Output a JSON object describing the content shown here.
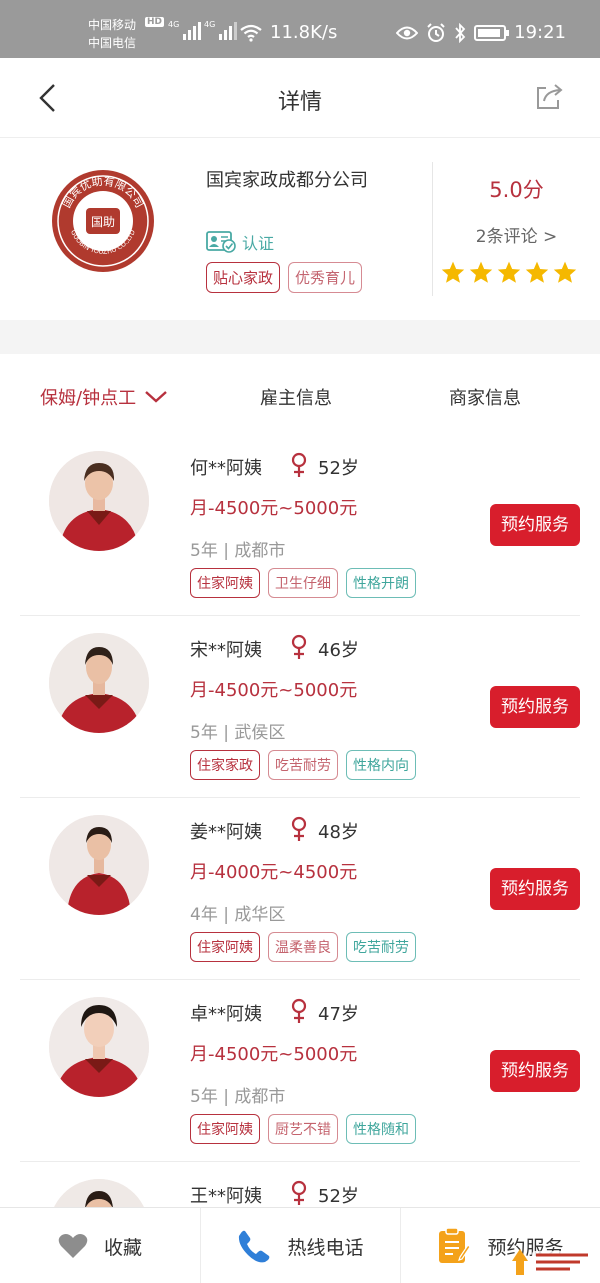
{
  "status_bar": {
    "carrier1": "中国移动",
    "carrier2": "中国电信",
    "hd": "HD",
    "net1": "4G",
    "net2": "4G",
    "speed": "11.8K/s",
    "time": "19:21"
  },
  "nav": {
    "title": "详情"
  },
  "company": {
    "name": "国宾家政成都分公司",
    "logo_text": "国宾优助有限公司",
    "logo_en": "GUOBIN YOUZHU CO.,LTD",
    "logo_mark": "国助",
    "cert_label": "认证",
    "tags": [
      "贴心家政",
      "优秀育儿"
    ],
    "score": "5.0分",
    "reviews": "2条评论 >",
    "stars": 5
  },
  "tabs": [
    "保姆/钟点工",
    "雇主信息",
    "商家信息"
  ],
  "workers": [
    {
      "name": "何**阿姨",
      "age": "52岁",
      "salary": "月-4500元~5000元",
      "meta": "5年 | 成都市",
      "tags": [
        "住家阿姨",
        "卫生仔细",
        "性格开朗"
      ],
      "button": "预约服务"
    },
    {
      "name": "宋**阿姨",
      "age": "46岁",
      "salary": "月-4500元~5000元",
      "meta": "5年 | 武侯区",
      "tags": [
        "住家家政",
        "吃苦耐劳",
        "性格内向"
      ],
      "button": "预约服务"
    },
    {
      "name": "姜**阿姨",
      "age": "48岁",
      "salary": "月-4000元~4500元",
      "meta": "4年 | 成华区",
      "tags": [
        "住家阿姨",
        "温柔善良",
        "吃苦耐劳"
      ],
      "button": "预约服务"
    },
    {
      "name": "卓**阿姨",
      "age": "47岁",
      "salary": "月-4500元~5000元",
      "meta": "5年 | 成都市",
      "tags": [
        "住家阿姨",
        "厨艺不错",
        "性格随和"
      ],
      "button": "预约服务"
    },
    {
      "name": "王**阿姨",
      "age": "52岁"
    }
  ],
  "bottom": {
    "fav": "收藏",
    "hotline": "热线电话",
    "book": "预约服务"
  },
  "colors": {
    "accent": "#b7313e",
    "button": "#d81e2c",
    "teal": "#49a9a4",
    "star": "#f5b800"
  },
  "icons": [
    "back-icon",
    "share-icon",
    "cert-icon",
    "star-icon",
    "chevron-down-icon",
    "female-icon",
    "heart-icon",
    "phone-icon",
    "document-icon"
  ]
}
